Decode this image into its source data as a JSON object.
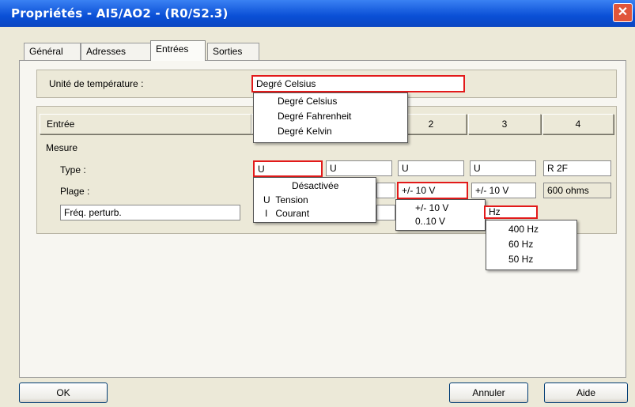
{
  "window": {
    "title": "Propriétés - AI5/AO2 - (R0/S2.3)",
    "close_glyph": "✕"
  },
  "tabs": [
    "Général",
    "Adresses",
    "Entrées",
    "Sorties"
  ],
  "temperature": {
    "label": "Unité de température :",
    "value": "Degré Celsius",
    "options": [
      "Degré Celsius",
      "Degré Fahrenheit",
      "Degré Kelvin"
    ]
  },
  "table": {
    "header_label": "Entrée",
    "columns": [
      "2",
      "3",
      "4"
    ],
    "section_label": "Mesure",
    "type_label": "Type :",
    "plage_label": "Plage :",
    "type_values": [
      "U",
      "U",
      "U",
      "U",
      "R 2F"
    ],
    "plage_values": [
      "+/- 10 V",
      "+/- 10 V",
      "600 ohms"
    ],
    "freq_label": "Fréq. perturb.",
    "freq_value": "Hz"
  },
  "type_dropdown": [
    {
      "code": "",
      "label": "Désactivée"
    },
    {
      "code": "U",
      "label": "Tension"
    },
    {
      "code": "I",
      "label": "Courant"
    }
  ],
  "plage_dropdown": [
    "+/- 10 V",
    "0..10 V"
  ],
  "freq_dropdown": [
    "400 Hz",
    "60 Hz",
    "50 Hz"
  ],
  "buttons": {
    "ok": "OK",
    "cancel": "Annuler",
    "help": "Aide"
  },
  "colors": {
    "highlight": "#e21a1a",
    "title_bar": "#0a4fd6",
    "dialog_bg": "#ece9d8"
  }
}
